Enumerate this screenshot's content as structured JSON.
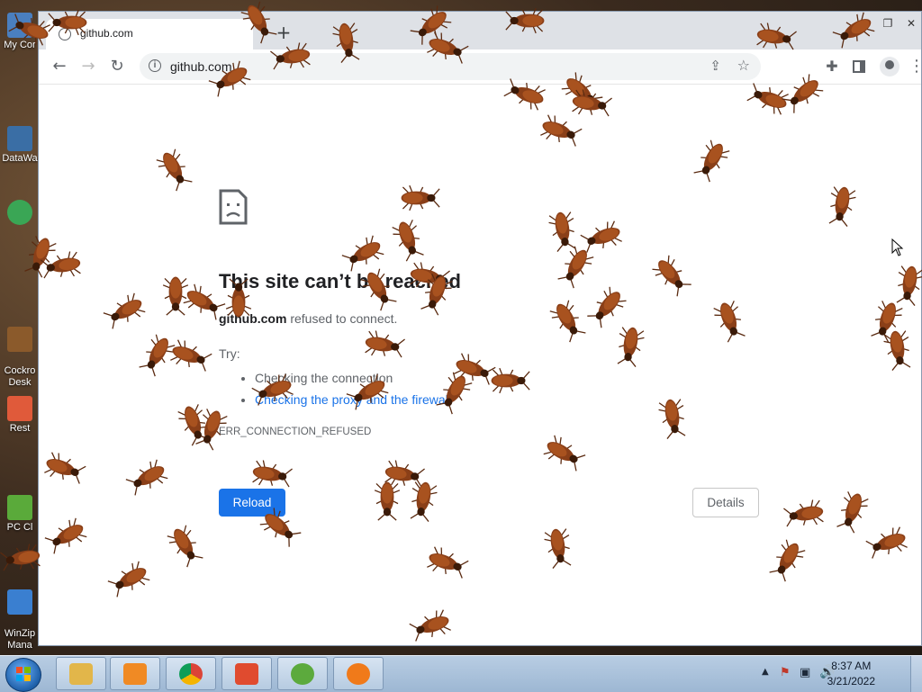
{
  "desktop": {
    "icons": [
      {
        "label": "My Cor",
        "color": "#4a7fbf"
      },
      {
        "label": "DataWa",
        "color": "#3a6ea5"
      },
      {
        "label": "",
        "color": "#3aa655"
      },
      {
        "label": "Cockro\nDesk",
        "color": "#8b5a2b"
      },
      {
        "label": "Rest",
        "color": "#e05a3a"
      },
      {
        "label": "PC Cl",
        "color": "#5aaa3a"
      },
      {
        "label": "WinZip\nMana",
        "color": "#3a7fd0"
      }
    ]
  },
  "browser": {
    "tab": {
      "title": "github.com"
    },
    "omnibox": {
      "url": "github.com"
    },
    "error": {
      "title": "This site can’t be reached",
      "host": "github.com",
      "desc": " refused to connect.",
      "try_label": "Try:",
      "tips": [
        "Checking the connection",
        "Checking the proxy and the firewall"
      ],
      "code": "ERR_CONNECTION_REFUSED",
      "reload_label": "Reload",
      "details_label": "Details"
    }
  },
  "taskbar": {
    "apps": [
      {
        "name": "file-explorer",
        "color": "#e2b64a"
      },
      {
        "name": "media-player",
        "color": "#f08a24"
      },
      {
        "name": "chrome",
        "color": "#db4437"
      },
      {
        "name": "app-red",
        "color": "#e04b2f"
      },
      {
        "name": "app-shield",
        "color": "#5caa3d"
      },
      {
        "name": "avast",
        "color": "#f07a1a"
      }
    ],
    "clock": {
      "time": "8:37 AM",
      "date": "3/21/2022"
    }
  },
  "theme": {
    "accent": "#1a73e8",
    "roach": "#8a3f18"
  }
}
